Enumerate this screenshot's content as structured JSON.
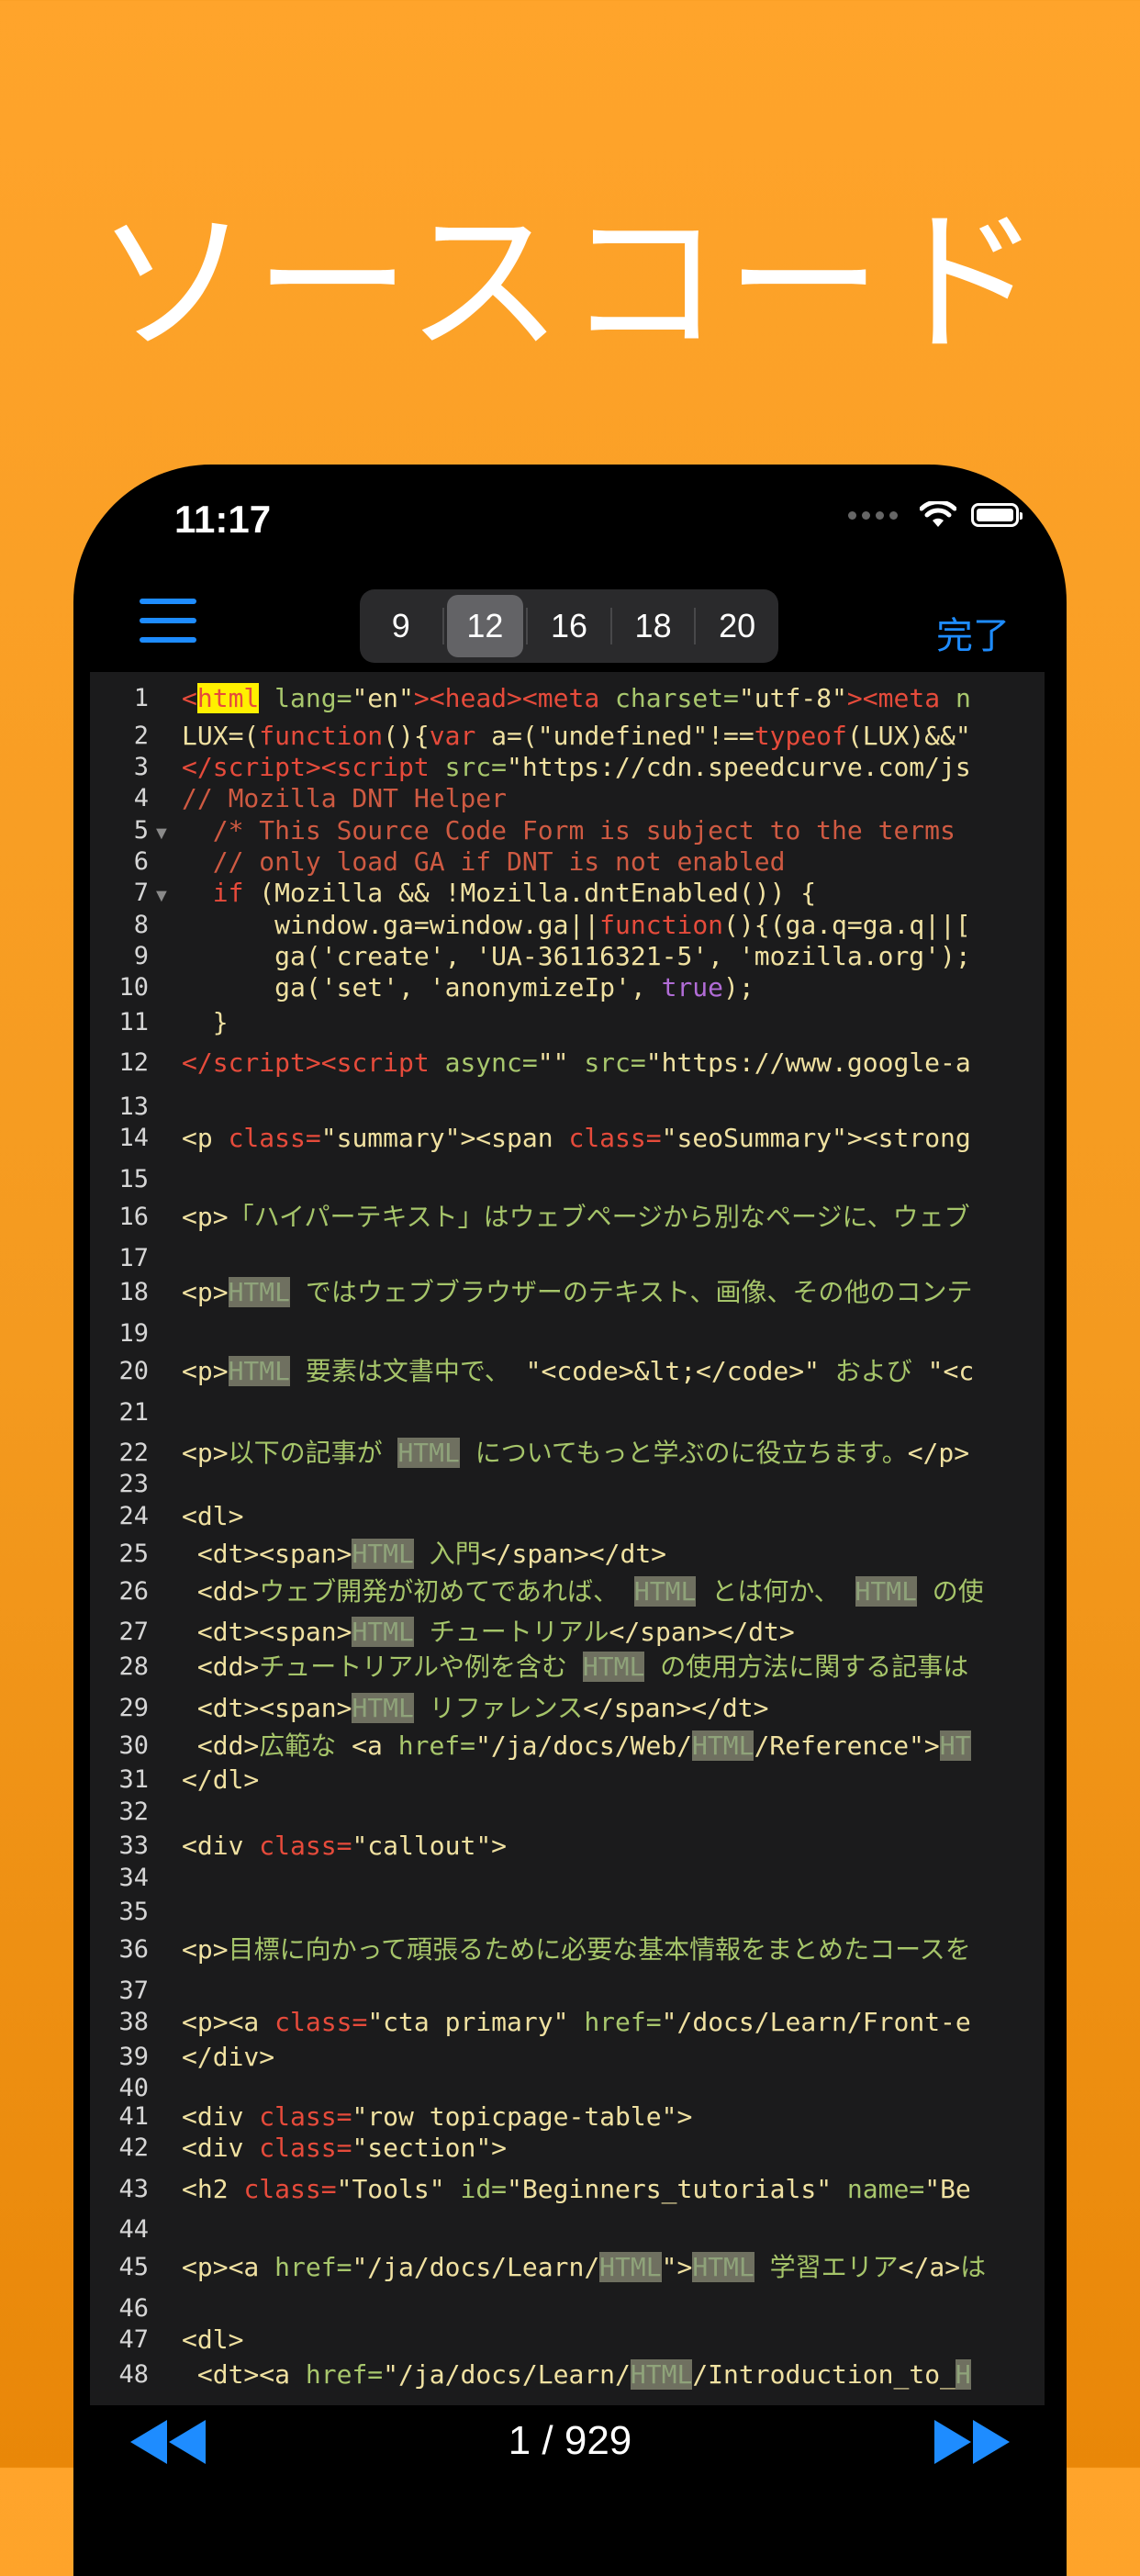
{
  "hero_title": "ソースコード",
  "status": {
    "time": "11:17"
  },
  "toolbar": {
    "font_sizes": [
      "9",
      "12",
      "16",
      "18",
      "20"
    ],
    "selected_font_size": "12",
    "done_label": "完了"
  },
  "code_lines": [
    {
      "n": "1",
      "html": "<span class=\"t\">&lt;</span><span class=\"hly\">html</span> <span class=\"a\">lang=</span><span class=\"s\">\"en\"</span><span class=\"t\">&gt;&lt;head&gt;&lt;meta</span> <span class=\"a\">charset=</span><span class=\"s\">\"utf-8\"</span><span class=\"t\">&gt;&lt;meta</span> <span class=\"a\">n</span>"
    },
    {
      "n": "2",
      "html": "<span class=\"s\">LUX=(</span><span class=\"t\">function</span><span class=\"s\">(){</span><span class=\"t\">var</span> <span class=\"s\">a=(\"undefined\"!==</span><span class=\"t\">typeof</span><span class=\"s\">(LUX)&amp;&amp;\"</span>"
    },
    {
      "n": "3",
      "html": "<span class=\"t\">&lt;/script&gt;&lt;script</span> <span class=\"a\">src=</span><span class=\"s\">\"https://cdn.speedcurve.com/js</span>"
    },
    {
      "n": "4",
      "html": "<span class=\"c\">// Mozilla DNT Helper</span>"
    },
    {
      "n": "5",
      "fold": true,
      "html": "  <span class=\"c\">/* This Source Code Form is subject to the terms</span>"
    },
    {
      "n": "6",
      "html": "  <span class=\"c\">// only load GA if DNT is not enabled</span>"
    },
    {
      "n": "7",
      "fold": true,
      "html": "  <span class=\"t\">if</span> <span class=\"s\">(Mozilla &amp;&amp; !Mozilla.dntEnabled()) {</span>"
    },
    {
      "n": "8",
      "html": "      <span class=\"s\">window.ga=window.ga||</span><span class=\"t\">function</span><span class=\"s\">(){(ga.q=ga.q||[</span>"
    },
    {
      "n": "9",
      "html": "      <span class=\"s\">ga('create', 'UA-36116321-5', 'mozilla.org');</span>"
    },
    {
      "n": "10",
      "html": "      <span class=\"s\">ga('set', 'anonymizeIp', </span><span class=\"k\">true</span><span class=\"s\">);</span>"
    },
    {
      "n": "11",
      "html": "  <span class=\"s\">}</span>"
    },
    {
      "n": "12",
      "html": "<span class=\"t\">&lt;/script&gt;&lt;script</span> <span class=\"a\">async=</span><span class=\"s\">\"\"</span> <span class=\"a\">src=</span><span class=\"s\">\"https://www.google-a</span>"
    },
    {
      "n": "13",
      "html": ""
    },
    {
      "n": "14",
      "html": "<span class=\"s\">&lt;p</span> <span class=\"t\">class=</span><span class=\"s\">\"summary\"&gt;&lt;span</span> <span class=\"t\">class=</span><span class=\"s\">\"seoSummary\"&gt;&lt;strong</span>"
    },
    {
      "n": "15",
      "html": ""
    },
    {
      "n": "16",
      "html": "<span class=\"s\">&lt;p&gt;</span><span class=\"p\">「ハイパーテキスト」はウェブページから別なページに、ウェブ</span>"
    },
    {
      "n": "17",
      "html": ""
    },
    {
      "n": "18",
      "html": "<span class=\"s\">&lt;p&gt;</span><span class=\"hlg\">HTML</span> <span class=\"p\">ではウェブブラウザーのテキスト、画像、その他のコンテ</span>"
    },
    {
      "n": "19",
      "html": ""
    },
    {
      "n": "20",
      "html": "<span class=\"s\">&lt;p&gt;</span><span class=\"hlg\">HTML</span> <span class=\"p\">要素は文書中で、 </span><span class=\"s\">\"&lt;code&gt;&amp;lt;&lt;/code&gt;\"</span> <span class=\"p\">および </span><span class=\"s\">\"&lt;c</span>"
    },
    {
      "n": "21",
      "html": ""
    },
    {
      "n": "22",
      "html": "<span class=\"s\">&lt;p&gt;</span><span class=\"p\">以下の記事が </span><span class=\"hlg\">HTML</span> <span class=\"p\">についてもっと学ぶのに役立ちます。</span><span class=\"s\">&lt;/p&gt;</span>"
    },
    {
      "n": "23",
      "html": ""
    },
    {
      "n": "24",
      "html": "<span class=\"s\">&lt;dl&gt;</span>"
    },
    {
      "n": "25",
      "html": " <span class=\"s\">&lt;dt&gt;&lt;span&gt;</span><span class=\"hlg\">HTML</span> <span class=\"p\">入門</span><span class=\"s\">&lt;/span&gt;&lt;/dt&gt;</span>"
    },
    {
      "n": "26",
      "html": " <span class=\"s\">&lt;dd&gt;</span><span class=\"p\">ウェブ開発が初めてであれば、 </span><span class=\"hlg\">HTML</span> <span class=\"p\">とは何か、 </span><span class=\"hlg\">HTML</span> <span class=\"p\">の使</span>"
    },
    {
      "n": "27",
      "html": " <span class=\"s\">&lt;dt&gt;&lt;span&gt;</span><span class=\"hlg\">HTML</span> <span class=\"p\">チュートリアル</span><span class=\"s\">&lt;/span&gt;&lt;/dt&gt;</span>"
    },
    {
      "n": "28",
      "html": " <span class=\"s\">&lt;dd&gt;</span><span class=\"p\">チュートリアルや例を含む </span><span class=\"hlg\">HTML</span> <span class=\"p\">の使用方法に関する記事は</span>"
    },
    {
      "n": "29",
      "html": " <span class=\"s\">&lt;dt&gt;&lt;span&gt;</span><span class=\"hlg\">HTML</span> <span class=\"p\">リファレンス</span><span class=\"s\">&lt;/span&gt;&lt;/dt&gt;</span>"
    },
    {
      "n": "30",
      "html": " <span class=\"s\">&lt;dd&gt;</span><span class=\"p\">広範な </span><span class=\"s\">&lt;a</span> <span class=\"a\">href=</span><span class=\"s\">\"/ja/docs/Web/</span><span class=\"hlg\">HTML</span><span class=\"s\">/Reference\"&gt;</span><span class=\"hlg\">HT</span>"
    },
    {
      "n": "31",
      "html": "<span class=\"s\">&lt;/dl&gt;</span>"
    },
    {
      "n": "32",
      "html": ""
    },
    {
      "n": "33",
      "html": "<span class=\"s\">&lt;div</span> <span class=\"t\">class=</span><span class=\"s\">\"callout\"&gt;</span>"
    },
    {
      "n": "34",
      "html": ""
    },
    {
      "n": "35",
      "html": ""
    },
    {
      "n": "36",
      "html": "<span class=\"s\">&lt;p&gt;</span><span class=\"p\">目標に向かって頑張るために必要な基本情報をまとめたコースを</span>"
    },
    {
      "n": "37",
      "html": ""
    },
    {
      "n": "38",
      "html": "<span class=\"s\">&lt;p&gt;&lt;a</span> <span class=\"t\">class=</span><span class=\"s\">\"cta primary\"</span> <span class=\"a\">href=</span><span class=\"s\">\"/docs/Learn/Front-e</span>"
    },
    {
      "n": "39",
      "html": "<span class=\"s\">&lt;/div&gt;</span>"
    },
    {
      "n": "40",
      "html": ""
    },
    {
      "n": "41",
      "html": "<span class=\"s\">&lt;div</span> <span class=\"t\">class=</span><span class=\"s\">\"row topicpage-table\"&gt;</span>"
    },
    {
      "n": "42",
      "html": "<span class=\"s\">&lt;div</span> <span class=\"t\">class=</span><span class=\"s\">\"section\"&gt;</span>"
    },
    {
      "n": "43",
      "html": "<span class=\"s\">&lt;h2</span> <span class=\"t\">class=</span><span class=\"s\">\"Tools\"</span> <span class=\"a\">id=</span><span class=\"s\">\"Beginners_tutorials\"</span> <span class=\"a\">name=</span><span class=\"s\">\"Be</span>"
    },
    {
      "n": "44",
      "html": ""
    },
    {
      "n": "45",
      "html": "<span class=\"s\">&lt;p&gt;&lt;a</span> <span class=\"a\">href=</span><span class=\"s\">\"/ja/docs/Learn/</span><span class=\"hlg\">HTML</span><span class=\"s\">\"&gt;</span><span class=\"hlg\">HTML</span> <span class=\"p\">学習エリア</span><span class=\"s\">&lt;/a&gt;</span><span class=\"p\">は</span>"
    },
    {
      "n": "46",
      "html": ""
    },
    {
      "n": "47",
      "html": "<span class=\"s\">&lt;dl&gt;</span>"
    },
    {
      "n": "48",
      "html": " <span class=\"s\">&lt;dt&gt;&lt;a</span> <span class=\"a\">href=</span><span class=\"s\">\"/ja/docs/Learn/</span><span class=\"hlg\">HTML</span><span class=\"s\">/Introduction_to_</span><span class=\"hlg\">H</span>"
    }
  ],
  "pager": {
    "indicator": "1 / 929"
  },
  "icons": {
    "menu": "hamburger-icon",
    "prev": "rewind-icon",
    "next": "fast-forward-icon",
    "wifi": "wifi-icon",
    "battery": "battery-icon"
  },
  "colors": {
    "background_top": "#FFA42B",
    "accent_blue": "#1e8cff",
    "code_bg": "#1b1b1c",
    "tag_red": "#e64b3b",
    "attr_green": "#a8c76d",
    "string_yellow": "#f0e1a1",
    "search_highlight": "#fff000"
  }
}
